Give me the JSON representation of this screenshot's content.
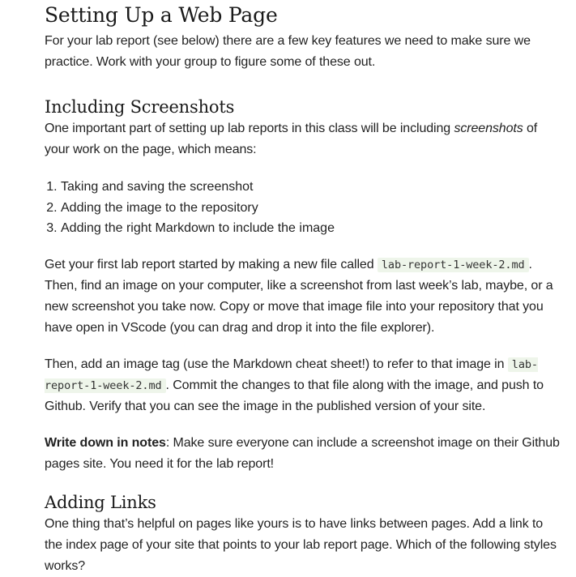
{
  "section": {
    "title": "Setting Up a Web Page",
    "intro": "For your lab report (see below) there are a few key features we need to make sure we practice. Work with your group to figure some of these out."
  },
  "screenshots": {
    "heading": "Including Screenshots",
    "intro_before": "One important part of setting up lab reports in this class will be including ",
    "intro_em": "screenshots",
    "intro_after": " of your work on the page, which means:",
    "steps": [
      "Taking and saving the screenshot",
      "Adding the image to the repository",
      "Adding the right Markdown to include the image"
    ],
    "para1_before": "Get your first lab report started by making a new file called ",
    "filename": "lab-report-1-week-2.md",
    "para1_after": ". Then, find an image on your computer, like a screenshot from last week’s lab, maybe, or a new screenshot you take now. Copy or move that image file into your repository that you have open in VScode (you can drag and drop it into the file explorer).",
    "para2_before": "Then, add an image tag (use the Markdown cheat sheet!) to refer to that image in ",
    "filename2": "lab-report-1-week-2.md",
    "para2_after": ". Commit the changes to that file along with the image, and push to Github. Verify that you can see the image in the published version of your site.",
    "note_label": "Write down in notes",
    "note_text": ": Make sure everyone can include a screenshot image on their Github pages site. You need it for the lab report!"
  },
  "links": {
    "heading": "Adding Links",
    "intro": "One thing that’s helpful on pages like yours is to have links between pages. Add a link to the index page of your site that points to your lab report page. Which of the following styles works?"
  }
}
